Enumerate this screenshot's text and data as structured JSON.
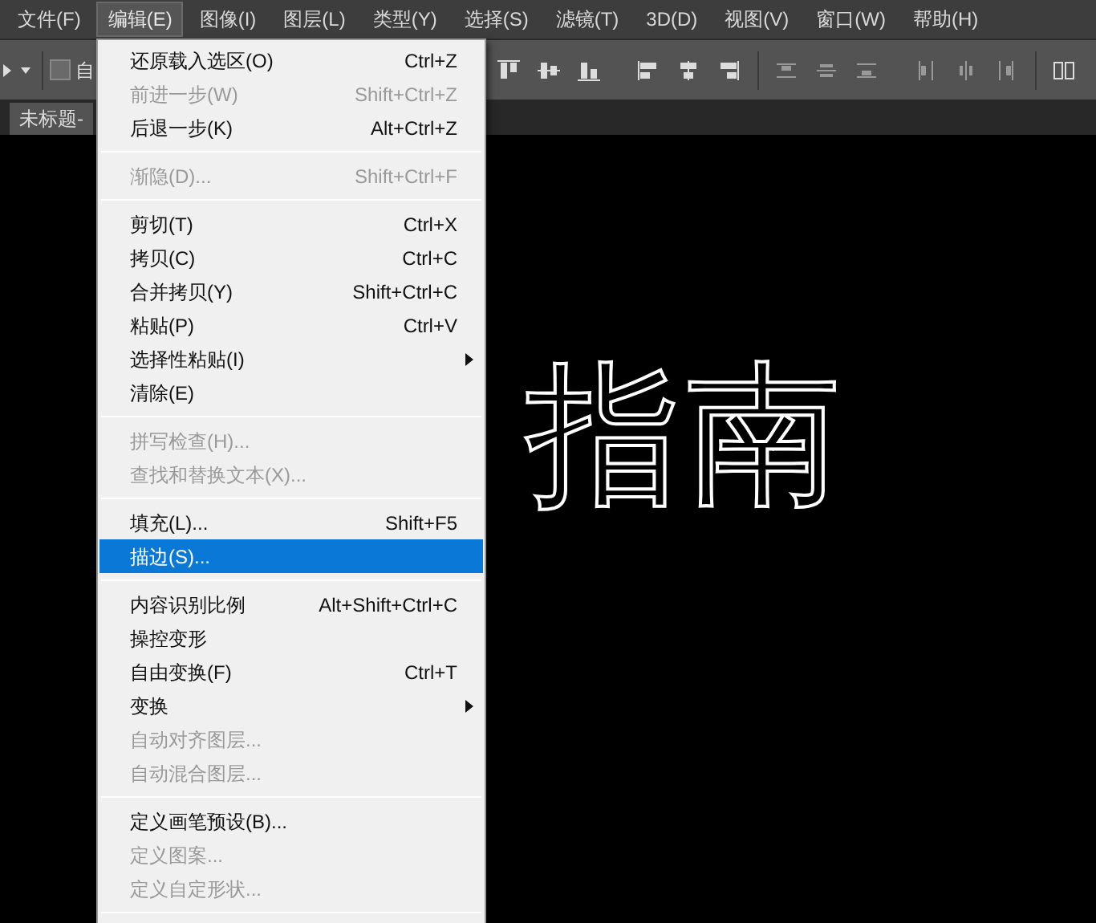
{
  "menubar": [
    {
      "label": "文件(F)",
      "selected": false
    },
    {
      "label": "编辑(E)",
      "selected": true
    },
    {
      "label": "图像(I)",
      "selected": false
    },
    {
      "label": "图层(L)",
      "selected": false
    },
    {
      "label": "类型(Y)",
      "selected": false
    },
    {
      "label": "选择(S)",
      "selected": false
    },
    {
      "label": "滤镜(T)",
      "selected": false
    },
    {
      "label": "3D(D)",
      "selected": false
    },
    {
      "label": "视图(V)",
      "selected": false
    },
    {
      "label": "窗口(W)",
      "selected": false
    },
    {
      "label": "帮助(H)",
      "selected": false
    }
  ],
  "options_bar": {
    "auto_select": {
      "label": "自",
      "checked": false
    }
  },
  "document_tab": {
    "title": "未标题-"
  },
  "canvas": {
    "selection_text": "指南"
  },
  "edit_menu": [
    {
      "kind": "item",
      "label": "还原载入选区(O)",
      "shortcut": "Ctrl+Z",
      "disabled": false,
      "selected": false,
      "submenu": false
    },
    {
      "kind": "item",
      "label": "前进一步(W)",
      "shortcut": "Shift+Ctrl+Z",
      "disabled": true,
      "selected": false,
      "submenu": false
    },
    {
      "kind": "item",
      "label": "后退一步(K)",
      "shortcut": "Alt+Ctrl+Z",
      "disabled": false,
      "selected": false,
      "submenu": false
    },
    {
      "kind": "separator"
    },
    {
      "kind": "item",
      "label": "渐隐(D)...",
      "shortcut": "Shift+Ctrl+F",
      "disabled": true,
      "selected": false,
      "submenu": false
    },
    {
      "kind": "separator"
    },
    {
      "kind": "item",
      "label": "剪切(T)",
      "shortcut": "Ctrl+X",
      "disabled": false,
      "selected": false,
      "submenu": false
    },
    {
      "kind": "item",
      "label": "拷贝(C)",
      "shortcut": "Ctrl+C",
      "disabled": false,
      "selected": false,
      "submenu": false
    },
    {
      "kind": "item",
      "label": "合并拷贝(Y)",
      "shortcut": "Shift+Ctrl+C",
      "disabled": false,
      "selected": false,
      "submenu": false
    },
    {
      "kind": "item",
      "label": "粘贴(P)",
      "shortcut": "Ctrl+V",
      "disabled": false,
      "selected": false,
      "submenu": false
    },
    {
      "kind": "item",
      "label": "选择性粘贴(I)",
      "disabled": false,
      "selected": false,
      "submenu": true
    },
    {
      "kind": "item",
      "label": "清除(E)",
      "disabled": false,
      "selected": false,
      "submenu": false
    },
    {
      "kind": "separator"
    },
    {
      "kind": "item",
      "label": "拼写检查(H)...",
      "disabled": true,
      "selected": false,
      "submenu": false
    },
    {
      "kind": "item",
      "label": "查找和替换文本(X)...",
      "disabled": true,
      "selected": false,
      "submenu": false
    },
    {
      "kind": "separator"
    },
    {
      "kind": "item",
      "label": "填充(L)...",
      "shortcut": "Shift+F5",
      "disabled": false,
      "selected": false,
      "submenu": false
    },
    {
      "kind": "item",
      "label": "描边(S)...",
      "disabled": false,
      "selected": true,
      "submenu": false
    },
    {
      "kind": "separator"
    },
    {
      "kind": "item",
      "label": "内容识别比例",
      "shortcut": "Alt+Shift+Ctrl+C",
      "disabled": false,
      "selected": false,
      "submenu": false
    },
    {
      "kind": "item",
      "label": "操控变形",
      "disabled": false,
      "selected": false,
      "submenu": false
    },
    {
      "kind": "item",
      "label": "自由变换(F)",
      "shortcut": "Ctrl+T",
      "disabled": false,
      "selected": false,
      "submenu": false
    },
    {
      "kind": "item",
      "label": "变换",
      "disabled": false,
      "selected": false,
      "submenu": true
    },
    {
      "kind": "item",
      "label": "自动对齐图层...",
      "disabled": true,
      "selected": false,
      "submenu": false
    },
    {
      "kind": "item",
      "label": "自动混合图层...",
      "disabled": true,
      "selected": false,
      "submenu": false
    },
    {
      "kind": "separator"
    },
    {
      "kind": "item",
      "label": "定义画笔预设(B)...",
      "disabled": false,
      "selected": false,
      "submenu": false
    },
    {
      "kind": "item",
      "label": "定义图案...",
      "disabled": true,
      "selected": false,
      "submenu": false
    },
    {
      "kind": "item",
      "label": "定义自定形状...",
      "disabled": true,
      "selected": false,
      "submenu": false
    },
    {
      "kind": "separator"
    }
  ]
}
